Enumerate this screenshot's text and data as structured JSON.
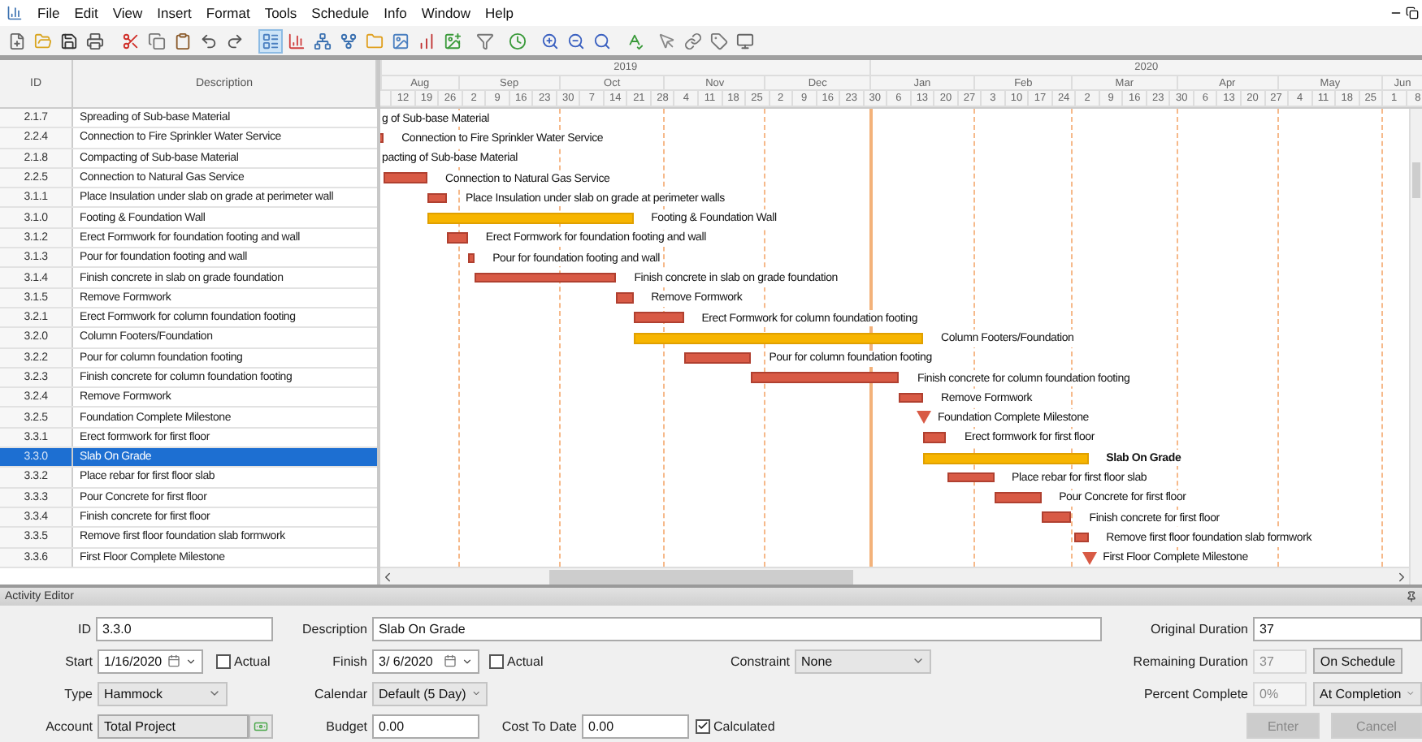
{
  "menu": [
    "File",
    "Edit",
    "View",
    "Insert",
    "Format",
    "Tools",
    "Schedule",
    "Info",
    "Window",
    "Help"
  ],
  "table": {
    "columns": [
      "ID",
      "Description"
    ],
    "rows": [
      {
        "id": "2.1.7",
        "description": "Spreading of Sub-base Material",
        "selected": false,
        "kind": "task",
        "bar_label": "g of Sub-base Material"
      },
      {
        "id": "2.2.4",
        "description": "Connection to Fire Sprinkler Water Service",
        "selected": false,
        "kind": "task",
        "bar_label": "Connection to Fire Sprinkler Water Service"
      },
      {
        "id": "2.1.8",
        "description": "Compacting of Sub-base Material",
        "selected": false,
        "kind": "task",
        "bar_label": "pacting of Sub-base Material"
      },
      {
        "id": "2.2.5",
        "description": "Connection to Natural Gas Service",
        "selected": false,
        "kind": "task",
        "bar_label": "Connection to Natural Gas Service"
      },
      {
        "id": "3.1.1",
        "description": "Place Insulation under slab on grade at perimeter wall",
        "selected": false,
        "kind": "task",
        "bar_label": "Place Insulation under slab on grade at perimeter walls"
      },
      {
        "id": "3.1.0",
        "description": "Footing & Foundation Wall",
        "selected": false,
        "kind": "summary",
        "bar_label": "Footing & Foundation Wall"
      },
      {
        "id": "3.1.2",
        "description": "Erect Formwork for foundation footing and wall",
        "selected": false,
        "kind": "task",
        "bar_label": "Erect Formwork for foundation footing and wall"
      },
      {
        "id": "3.1.3",
        "description": "Pour for foundation footing and wall",
        "selected": false,
        "kind": "task",
        "bar_label": "Pour for foundation footing and wall"
      },
      {
        "id": "3.1.4",
        "description": "Finish concrete in slab on grade foundation",
        "selected": false,
        "kind": "task",
        "bar_label": "Finish concrete in slab on grade foundation"
      },
      {
        "id": "3.1.5",
        "description": "Remove Formwork",
        "selected": false,
        "kind": "task",
        "bar_label": "Remove Formwork"
      },
      {
        "id": "3.2.1",
        "description": "Erect Formwork for column foundation footing",
        "selected": false,
        "kind": "task",
        "bar_label": "Erect Formwork for column foundation footing"
      },
      {
        "id": "3.2.0",
        "description": "Column Footers/Foundation",
        "selected": false,
        "kind": "summary",
        "bar_label": "Column Footers/Foundation"
      },
      {
        "id": "3.2.2",
        "description": "Pour for column foundation footing",
        "selected": false,
        "kind": "task",
        "bar_label": "Pour for column foundation footing"
      },
      {
        "id": "3.2.3",
        "description": "Finish concrete for column foundation footing",
        "selected": false,
        "kind": "task",
        "bar_label": "Finish concrete for column foundation footing"
      },
      {
        "id": "3.2.4",
        "description": "Remove Formwork",
        "selected": false,
        "kind": "task",
        "bar_label": "Remove Formwork"
      },
      {
        "id": "3.2.5",
        "description": "Foundation Complete Milestone",
        "selected": false,
        "kind": "milestone",
        "bar_label": "Foundation Complete Milestone"
      },
      {
        "id": "3.3.1",
        "description": "Erect formwork for first floor",
        "selected": false,
        "kind": "task",
        "bar_label": "Erect formwork for first floor"
      },
      {
        "id": "3.3.0",
        "description": "Slab On Grade",
        "selected": true,
        "kind": "summary",
        "bar_label": "Slab On Grade"
      },
      {
        "id": "3.3.2",
        "description": "Place rebar for first floor slab",
        "selected": false,
        "kind": "task",
        "bar_label": "Place rebar for first floor slab"
      },
      {
        "id": "3.3.3",
        "description": "Pour Concrete for first floor",
        "selected": false,
        "kind": "task",
        "bar_label": "Pour Concrete for first floor"
      },
      {
        "id": "3.3.4",
        "description": "Finish concrete for first floor",
        "selected": false,
        "kind": "task",
        "bar_label": "Finish concrete for first floor"
      },
      {
        "id": "3.3.5",
        "description": "Remove first floor foundation slab formwork",
        "selected": false,
        "kind": "task",
        "bar_label": "Remove first floor foundation slab formwork"
      },
      {
        "id": "3.3.6",
        "description": "First Floor Complete Milestone",
        "selected": false,
        "kind": "milestone",
        "bar_label": "First Floor Complete Milestone"
      }
    ]
  },
  "timeline": {
    "years": [
      "2019",
      "2020"
    ],
    "months": [
      "Aug",
      "Sep",
      "Oct",
      "Nov",
      "Dec",
      "Jan",
      "Feb",
      "Mar",
      "Apr",
      "May",
      "Jun"
    ],
    "weeks": [
      "12",
      "19",
      "26",
      "2",
      "9",
      "16",
      "23",
      "30",
      "7",
      "14",
      "21",
      "28",
      "4",
      "11",
      "18",
      "25",
      "2",
      "9",
      "16",
      "23",
      "30",
      "6",
      "13",
      "20",
      "27",
      "3",
      "10",
      "17",
      "24",
      "2",
      "9",
      "16",
      "23",
      "30",
      "6",
      "13",
      "20",
      "27",
      "4",
      "11",
      "18",
      "25",
      "1",
      "8"
    ]
  },
  "editor": {
    "title": "Activity Editor",
    "id": {
      "label": "ID",
      "value": "3.3.0"
    },
    "description": {
      "label": "Description",
      "value": "Slab On Grade"
    },
    "original_duration": {
      "label": "Original Duration",
      "value": "37"
    },
    "start": {
      "label": "Start",
      "value": "1/16/2020",
      "actual_label": "Actual",
      "actual_checked": false
    },
    "finish": {
      "label": "Finish",
      "value": "3/ 6/2020",
      "actual_label": "Actual",
      "actual_checked": false
    },
    "constraint": {
      "label": "Constraint",
      "value": "None"
    },
    "remaining_duration": {
      "label": "Remaining Duration",
      "value": "37",
      "disabled": true
    },
    "on_schedule_button": "On Schedule",
    "type": {
      "label": "Type",
      "value": "Hammock"
    },
    "calendar": {
      "label": "Calendar",
      "value": "Default (5 Day)"
    },
    "percent_complete": {
      "label": "Percent Complete",
      "value": "0%",
      "disabled": true
    },
    "completion_select": "At Completion",
    "account": {
      "label": "Account",
      "value": "Total Project"
    },
    "budget": {
      "label": "Budget",
      "value": "0.00"
    },
    "cost_to_date": {
      "label": "Cost To Date",
      "value": "0.00"
    },
    "calculated": {
      "label": "Calculated",
      "checked": true
    },
    "buttons": [
      {
        "label": "Enter",
        "disabled": true
      },
      {
        "label": "Cancel",
        "disabled": true
      }
    ]
  }
}
